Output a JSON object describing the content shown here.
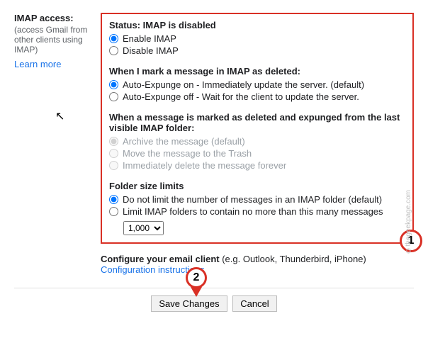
{
  "left": {
    "label": "IMAP access:",
    "sub": "(access Gmail from other clients using IMAP)",
    "learn": "Learn more"
  },
  "status": {
    "title": "Status: IMAP is disabled",
    "enable": "Enable IMAP",
    "disable": "Disable IMAP"
  },
  "mark": {
    "title": "When I mark a message in IMAP as deleted:",
    "on": "Auto-Expunge on - Immediately update the server. (default)",
    "off": "Auto-Expunge off - Wait for the client to update the server."
  },
  "expunged": {
    "title": "When a message is marked as deleted and expunged from the last visible IMAP folder:",
    "archive": "Archive the message (default)",
    "trash": "Move the message to the Trash",
    "delete": "Immediately delete the message forever"
  },
  "folder": {
    "title": "Folder size limits",
    "nolimit": "Do not limit the number of messages in an IMAP folder (default)",
    "limit": "Limit IMAP folders to contain no more than this many messages",
    "select_value": "1,000"
  },
  "configure": {
    "title_a": "Configure your email client",
    "title_b": " (e.g. Outlook, Thunderbird, iPhone)",
    "link": "Configuration instructions"
  },
  "buttons": {
    "save": "Save Changes",
    "cancel": "Cancel"
  },
  "markers": {
    "one": "1",
    "two": "2"
  },
  "watermark": "©thegeekpage.com"
}
